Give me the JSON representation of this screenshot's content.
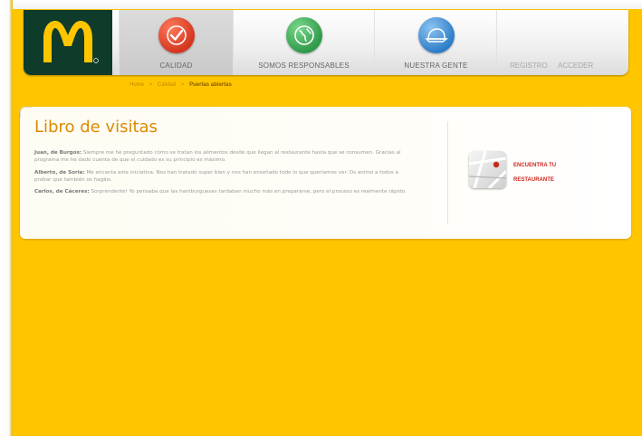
{
  "nav": {
    "items": [
      {
        "label": "CALIDAD",
        "icon": "checkmark-icon",
        "color": "#e0452b",
        "active": true
      },
      {
        "label": "SOMOS RESPONSABLES",
        "icon": "globe-icon",
        "color": "#3db05a",
        "active": false
      },
      {
        "label": "NUESTRA GENTE",
        "icon": "cap-icon",
        "color": "#3a8fd8",
        "active": false
      }
    ],
    "links": {
      "register": "REGISTRO",
      "login": "ACCEDER"
    },
    "logo": {
      "icon": "golden-arches-icon",
      "bg": "#0e3b2a",
      "color": "#ffc600"
    }
  },
  "breadcrumb": {
    "items": [
      "Home",
      "Calidad"
    ],
    "separator": ">",
    "current": "Puertas abiertas"
  },
  "page": {
    "title": "Libro de visitas",
    "entries": [
      {
        "author": "Juan, de Burgos:",
        "text": "Siempre me he preguntado cómo se tratan los alimentos desde que llegan al restaurante hasta que se consumen. Gracias al programa me he dado cuenta de que el cuidado es su principio es máximo."
      },
      {
        "author": "Alberto, de Soria:",
        "text": "Me encanta esta iniciativa. Nos han tratado super bien y nos han enseñado todo lo que queríamos ver. Os animo a todos a probar que también os hagáis."
      },
      {
        "author": "Carlos, de Cáceres:",
        "text": "Sorprendente! Yo pensaba que las hamburguesas tardaban mucho más en prepararse, pero el proceso es realmente rápido."
      }
    ]
  },
  "sidebar": {
    "finder_line1": "ENCUENTRA TU",
    "finder_line2": "RESTAURANTE",
    "icon": "map-pin-icon"
  },
  "colors": {
    "background": "#ffc600",
    "title": "#d98b00",
    "link_red": "#c8281f"
  }
}
